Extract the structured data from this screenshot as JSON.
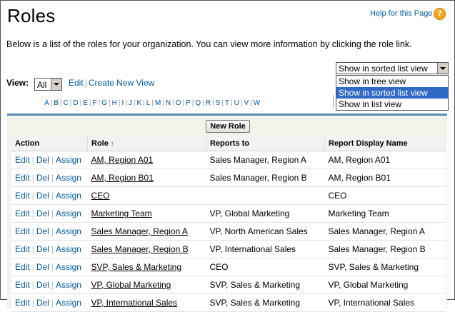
{
  "page": {
    "title": "Roles",
    "help_link": "Help for this Page",
    "description": "Below is a list of the roles for your organization. You can view more information by clicking the role link."
  },
  "show_dropdown": {
    "selected": "Show in sorted list view",
    "options": [
      "Show in tree view",
      "Show in sorted list view",
      "Show in list view"
    ]
  },
  "view": {
    "label": "View:",
    "selected": "All",
    "edit_link": "Edit",
    "create_link": "Create New View"
  },
  "alphabet": [
    "A",
    "B",
    "C",
    "D",
    "E",
    "F",
    "G",
    "H",
    "I",
    "J",
    "K",
    "L",
    "M",
    "N",
    "O",
    "P",
    "Q",
    "R",
    "S",
    "T",
    "U",
    "V",
    "W"
  ],
  "new_role_button": "New Role",
  "table": {
    "headers": {
      "action": "Action",
      "role": "Role",
      "reports_to": "Reports to",
      "display_name": "Report Display Name"
    },
    "action_labels": {
      "edit": "Edit",
      "del": "Del",
      "assign": "Assign"
    },
    "rows": [
      {
        "role": "AM, Region A01",
        "reports_to": "Sales Manager, Region A",
        "display_name": "AM, Region A01"
      },
      {
        "role": "AM, Region B01",
        "reports_to": "Sales Manager, Region B",
        "display_name": "AM, Region B01"
      },
      {
        "role": "CEO",
        "reports_to": "",
        "display_name": "CEO"
      },
      {
        "role": "Marketing Team",
        "reports_to": "VP, Global Marketing",
        "display_name": "Marketing Team"
      },
      {
        "role": "Sales Manager, Region A",
        "reports_to": "VP, North American Sales",
        "display_name": "Sales Manager, Region A"
      },
      {
        "role": "Sales Manager, Region B",
        "reports_to": "VP, International Sales",
        "display_name": "Sales Manager, Region B"
      },
      {
        "role": "SVP, Sales & Marketing",
        "reports_to": "CEO",
        "display_name": "SVP, Sales & Marketing"
      },
      {
        "role": "VP, Global Marketing",
        "reports_to": "SVP, Sales & Marketing",
        "display_name": "VP, Global Marketing"
      },
      {
        "role": "VP, International Sales",
        "reports_to": "SVP, Sales & Marketing",
        "display_name": "VP, International Sales"
      }
    ]
  }
}
